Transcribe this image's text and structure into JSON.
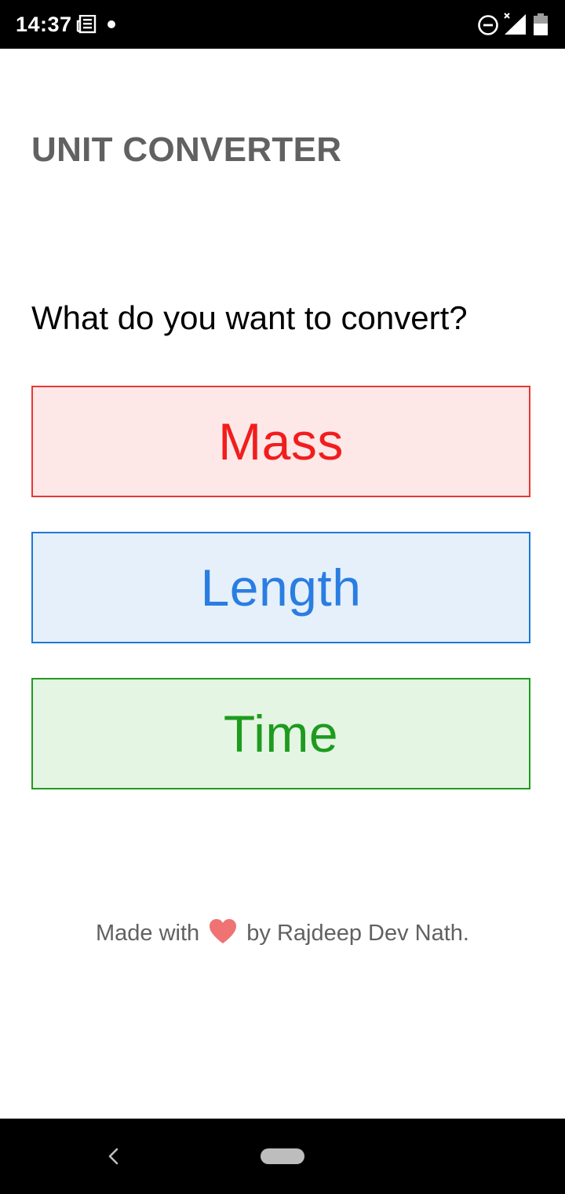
{
  "status_bar": {
    "time": "14:37",
    "icons": [
      "news-icon",
      "notification-dot-icon",
      "do-not-disturb-icon",
      "signal-icon",
      "battery-icon"
    ]
  },
  "app": {
    "title": "UNIT CONVERTER",
    "prompt": "What do you want to convert?"
  },
  "options": [
    {
      "label": "Mass",
      "text_color": "#f11d1d",
      "border_color": "#e53935",
      "bg_color": "#fde7e7"
    },
    {
      "label": "Length",
      "text_color": "#2a7de1",
      "border_color": "#1e78d8",
      "bg_color": "#e5f0fb"
    },
    {
      "label": "Time",
      "text_color": "#1e9b1e",
      "border_color": "#1f9c1f",
      "bg_color": "#e4f5e3"
    }
  ],
  "footer": {
    "before": "Made with",
    "after": "by Rajdeep Dev Nath.",
    "icon": "heart-icon",
    "heart_color": "#ef7373"
  },
  "nav_bar": {
    "icons": [
      "back-icon",
      "home-pill"
    ]
  }
}
